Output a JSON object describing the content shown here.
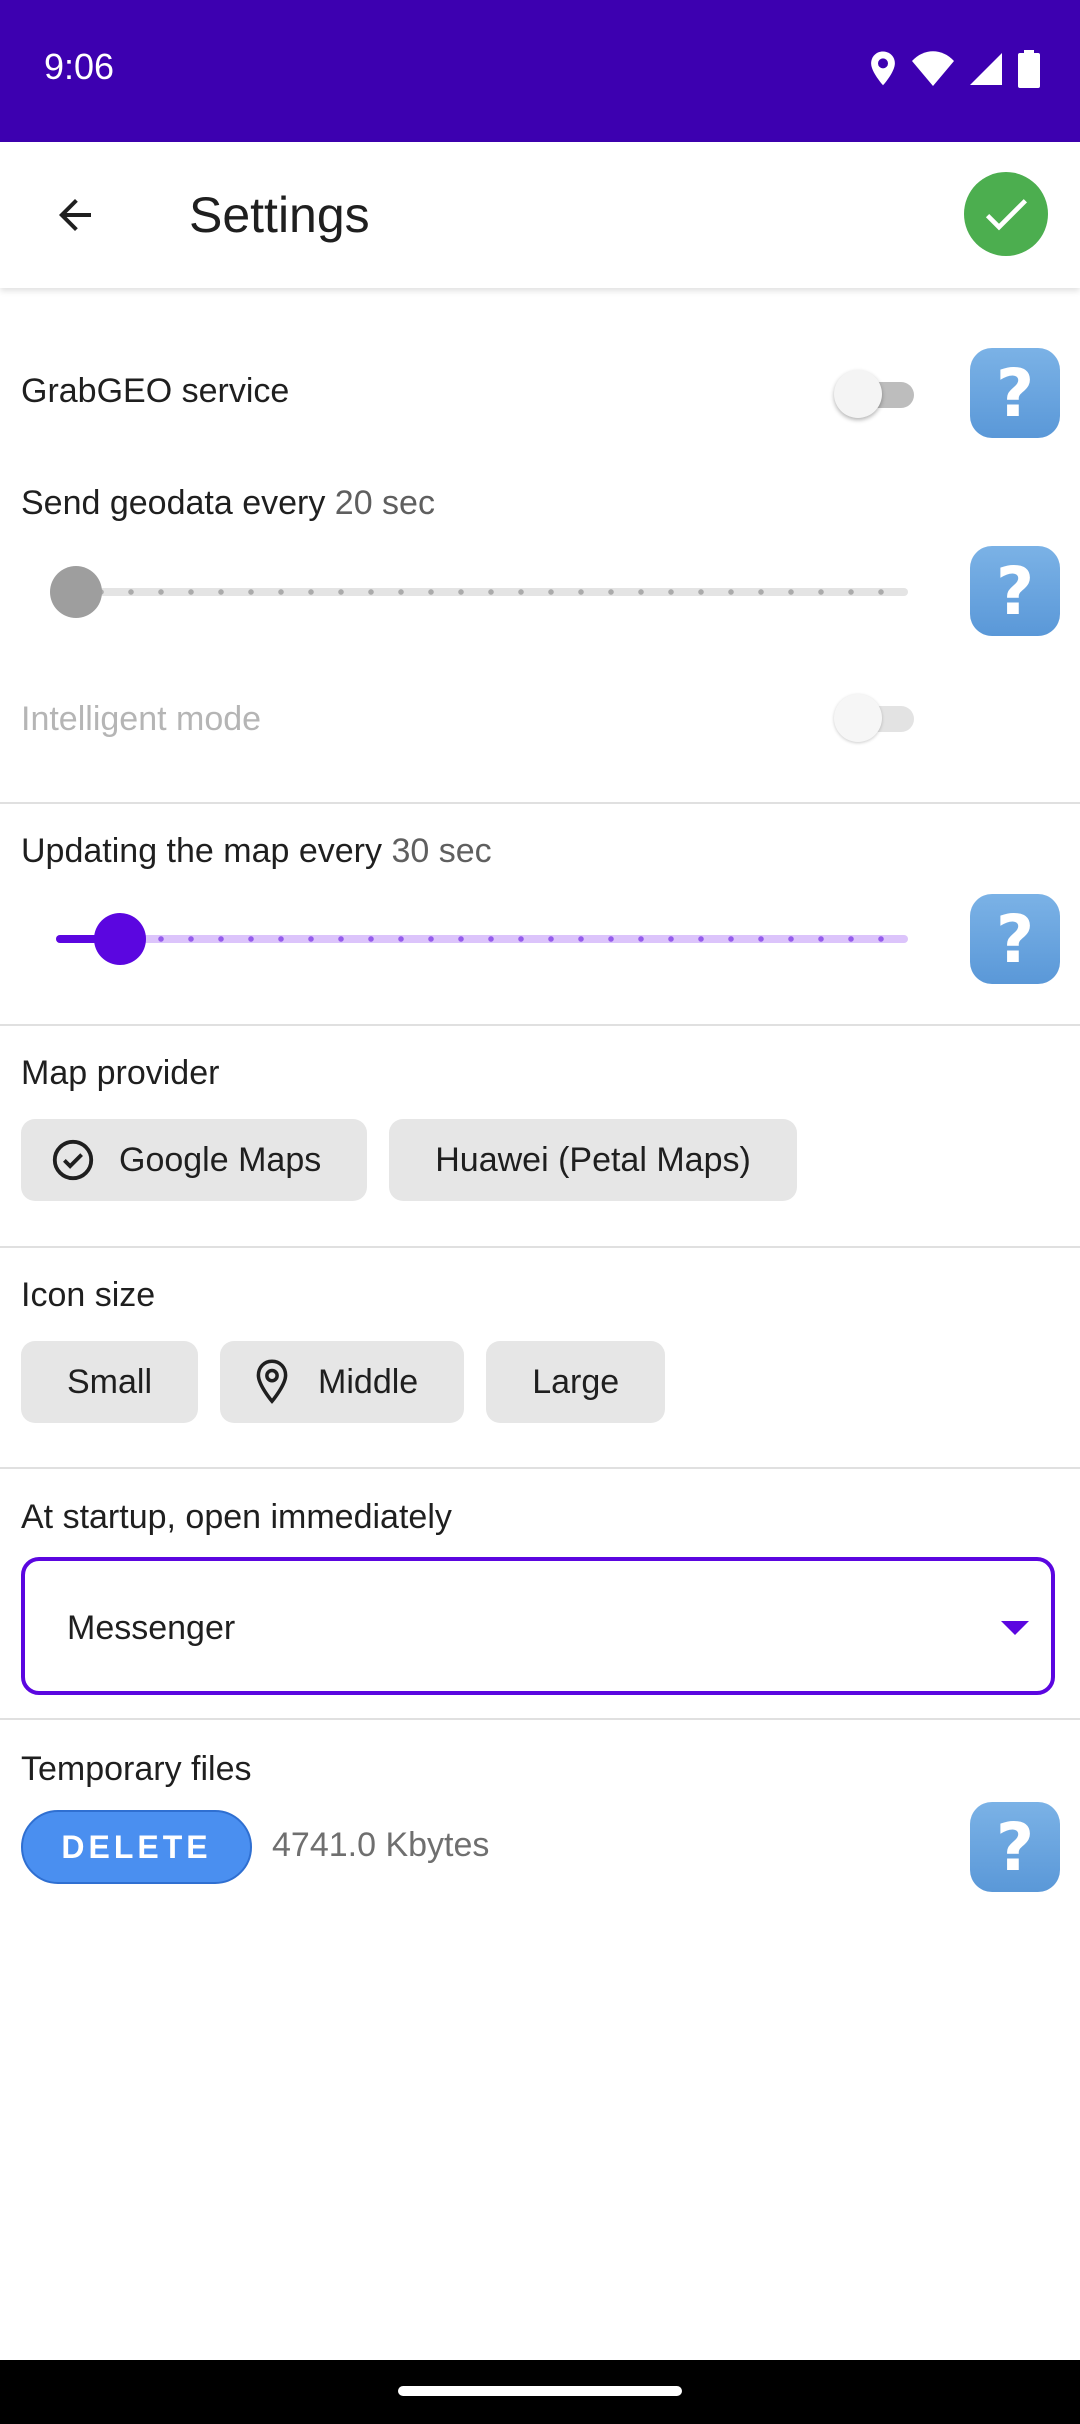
{
  "status": {
    "time": "9:06"
  },
  "header": {
    "title": "Settings"
  },
  "grabgeo": {
    "label": "GrabGEO service",
    "enabled": false
  },
  "geodata": {
    "label": "Send geodata every",
    "value": "20 sec",
    "slider_fraction": 0.0
  },
  "intelligent": {
    "label": "Intelligent mode",
    "enabled": false,
    "disabled": true
  },
  "map_update": {
    "label": "Updating the map every",
    "value": "30 sec",
    "slider_fraction": 0.07
  },
  "map_provider": {
    "label": "Map provider",
    "options": [
      {
        "label": "Google Maps",
        "selected": true
      },
      {
        "label": "Huawei (Petal Maps)",
        "selected": false
      }
    ]
  },
  "icon_size": {
    "label": "Icon size",
    "options": [
      {
        "label": "Small",
        "selected": false
      },
      {
        "label": "Middle",
        "selected": true
      },
      {
        "label": "Large",
        "selected": false
      }
    ]
  },
  "startup": {
    "label": "At startup, open immediately",
    "selected": "Messenger"
  },
  "temp_files": {
    "label": "Temporary files",
    "delete_label": "DELETE",
    "size": "4741.0 Kbytes"
  },
  "help": {
    "glyph": "?"
  },
  "colors": {
    "status_bar": "#3d00b0",
    "accent": "#5b06e0",
    "ok": "#4cae4f",
    "help": "#6aa6df",
    "delete": "#4a8ff0"
  }
}
